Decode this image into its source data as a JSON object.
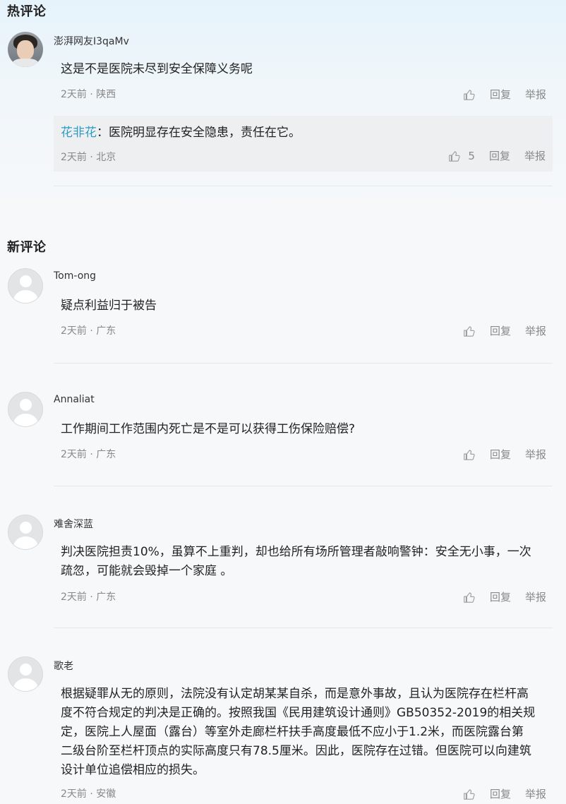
{
  "hot_section": {
    "title": "热评论"
  },
  "new_section": {
    "title": "新评论"
  },
  "actions": {
    "reply": "回复",
    "report": "举报"
  },
  "hot_comments": [
    {
      "username": "澎湃网友I3qaMv",
      "content": "这是不是医院未尽到安全保障义务呢",
      "meta": "2天前 · 陕西",
      "reply": {
        "username": "花非花",
        "separator": "：",
        "content": "医院明显存在安全隐患，责任在它。",
        "meta": "2天前 · 北京",
        "likes": "5"
      }
    }
  ],
  "new_comments": [
    {
      "username": "Tom-ong",
      "content": "疑点利益归于被告",
      "meta": "2天前 · 广东"
    },
    {
      "username": "Annaliat",
      "content": "工作期间工作范围内死亡是不是可以获得工伤保险赔偿?",
      "meta": "2天前 · 广东"
    },
    {
      "username": "难舍深蓝",
      "content_lines": [
        "判决医院担责10%，虽算不上重判，却也给所有场所管理者敲响警钟：安全无小事，一次",
        "疏忽，可能就会毁掉一个家庭 。"
      ],
      "meta": "2天前 · 广东"
    },
    {
      "username": "歌老",
      "content_lines": [
        "根据疑罪从无的原则，法院没有认定胡某某自杀，而是意外事故，且认为医院存在栏杆高",
        "度不符合规定的判决是正确的。按照我国《民用建筑设计通则》GB50352-2019的相关规",
        "定，医院上人屋面（露台）等室外走廊栏杆扶手高度最低不应小于1.2米，而医院露台第",
        "二级台阶至栏杆顶点的实际高度只有78.5厘米。因此，医院存在过错。但医院可以向建筑",
        "设计单位追偿相应的损失。"
      ],
      "meta": "2天前 · 安徽"
    }
  ]
}
